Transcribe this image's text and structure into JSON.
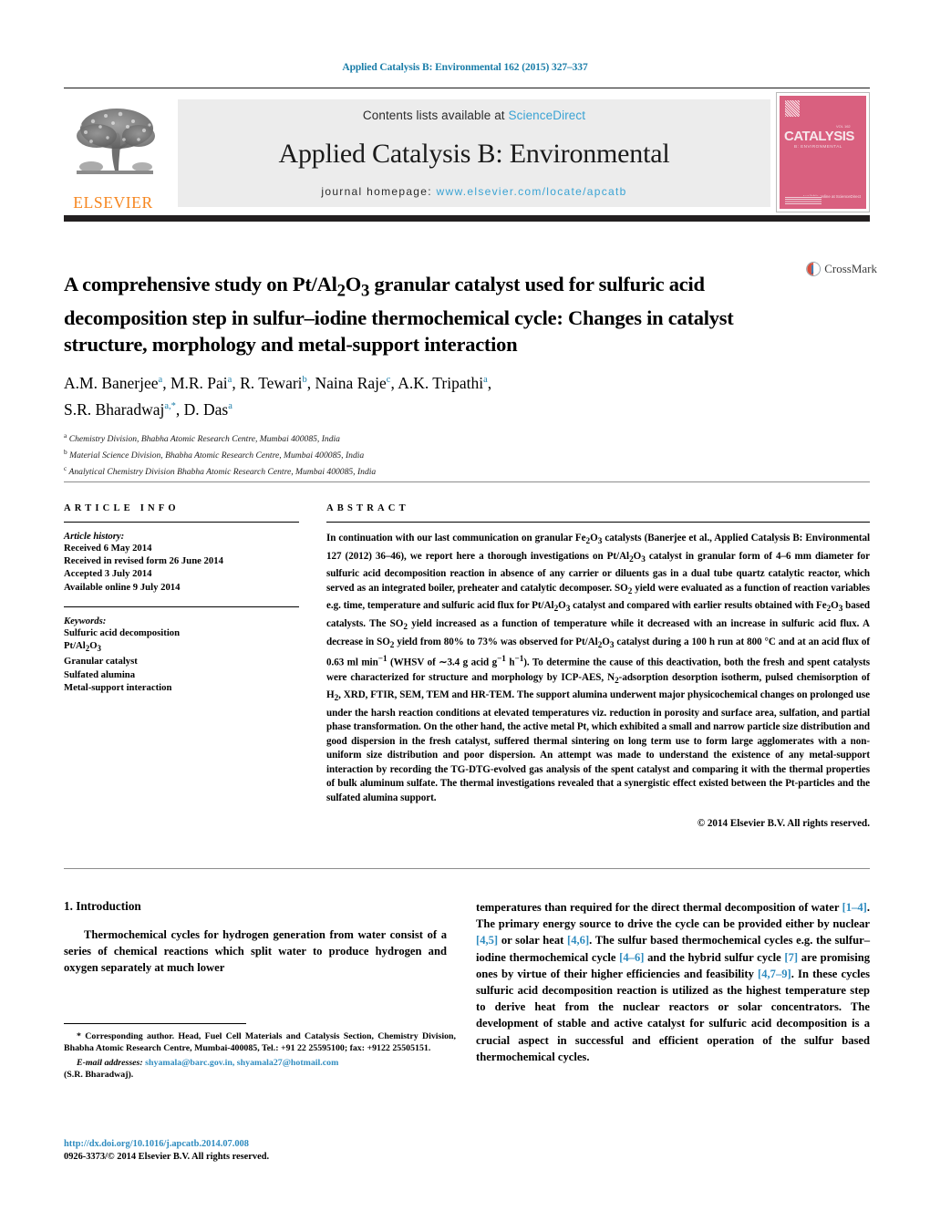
{
  "running_head": "Applied Catalysis B: Environmental 162 (2015) 327–337",
  "masthead": {
    "publisher_name": "ELSEVIER",
    "contents_prefix": "Contents lists available at ",
    "sciencedirect": "ScienceDirect",
    "journal_title": "Applied Catalysis B: Environmental",
    "homepage_label": "journal homepage: ",
    "homepage_url": "www.elsevier.com/locate/apcatb",
    "cover": {
      "title": "CATALYSIS",
      "subtitle": "B: ENVIRONMENTAL",
      "corner_tag": "VOL 162",
      "bottom_note": "Available online at\nScienceDirect",
      "color": "#d9607f"
    }
  },
  "crossmark": {
    "label": "CrossMark"
  },
  "article": {
    "title": "A comprehensive study on Pt/Al2O3 granular catalyst used for sulfuric acid decomposition step in sulfur–iodine thermochemical cycle: Changes in catalyst structure, morphology and metal-support interaction",
    "authors_line1": "A.M. Banerjee a, M.R. Pai a, R. Tewari b, Naina Raje c, A.K. Tripathi a,",
    "authors_line2": "S.R. Bharadwaj a,*, D. Das a",
    "affiliations": [
      {
        "marker": "a",
        "text": "Chemistry Division, Bhabha Atomic Research Centre, Mumbai 400085, India"
      },
      {
        "marker": "b",
        "text": "Material Science Division, Bhabha Atomic Research Centre, Mumbai 400085, India"
      },
      {
        "marker": "c",
        "text": "Analytical Chemistry Division Bhabha Atomic Research Centre, Mumbai 400085, India"
      }
    ]
  },
  "article_info": {
    "heading": "ARTICLE INFO",
    "history_label": "Article history:",
    "history": [
      "Received 6 May 2014",
      "Received in revised form 26 June 2014",
      "Accepted 3 July 2014",
      "Available online 9 July 2014"
    ],
    "keywords_label": "Keywords:",
    "keywords": [
      "Sulfuric acid decomposition",
      "Pt/Al2O3",
      "Granular catalyst",
      "Sulfated alumina",
      "Metal-support interaction"
    ]
  },
  "abstract": {
    "heading": "ABSTRACT",
    "text": "In continuation with our last communication on granular Fe2O3 catalysts (Banerjee et al., Applied Catalysis B: Environmental 127 (2012) 36–46), we report here a thorough investigations on Pt/Al2O3 catalyst in granular form of 4–6 mm diameter for sulfuric acid decomposition reaction in absence of any carrier or diluents gas in a dual tube quartz catalytic reactor, which served as an integrated boiler, preheater and catalytic decomposer. SO2 yield were evaluated as a function of reaction variables e.g. time, temperature and sulfuric acid flux for Pt/Al2O3 catalyst and compared with earlier results obtained with Fe2O3 based catalysts. The SO2 yield increased as a function of temperature while it decreased with an increase in sulfuric acid flux. A decrease in SO2 yield from 80% to 73% was observed for Pt/Al2O3 catalyst during a 100 h run at 800 °C and at an acid flux of 0.63 ml min−1 (WHSV of ∼3.4 g acid g−1 h−1). To determine the cause of this deactivation, both the fresh and spent catalysts were characterized for structure and morphology by ICP-AES, N2-adsorption desorption isotherm, pulsed chemisorption of H2, XRD, FTIR, SEM, TEM and HR-TEM. The support alumina underwent major physicochemical changes on prolonged use under the harsh reaction conditions at elevated temperatures viz. reduction in porosity and surface area, sulfation, and partial phase transformation. On the other hand, the active metal Pt, which exhibited a small and narrow particle size distribution and good dispersion in the fresh catalyst, suffered thermal sintering on long term use to form large agglomerates with a non-uniform size distribution and poor dispersion. An attempt was made to understand the existence of any metal-support interaction by recording the TG-DTG-evolved gas analysis of the spent catalyst and comparing it with the thermal properties of bulk aluminum sulfate. The thermal investigations revealed that a synergistic effect existed between the Pt-particles and the sulfated alumina support.",
    "copyright": "© 2014 Elsevier B.V. All rights reserved."
  },
  "body": {
    "section_number_title": "1. Introduction",
    "left_paragraph": "Thermochemical cycles for hydrogen generation from water consist of a series of chemical reactions which split water to produce hydrogen and oxygen separately at much lower",
    "right_paragraph_parts": [
      "temperatures than required for the direct thermal decomposition of water ",
      "[1–4]",
      ". The primary energy source to drive the cycle can be provided either by nuclear ",
      "[4,5]",
      " or solar heat ",
      "[4,6]",
      ". The sulfur based thermochemical cycles e.g. the sulfur–iodine thermochemical cycle ",
      "[4–6]",
      " and the hybrid sulfur cycle ",
      "[7]",
      " are promising ones by virtue of their higher efficiencies and feasibility ",
      "[4,7–9]",
      ". In these cycles sulfuric acid decomposition reaction is utilized as the highest temperature step to derive heat from the nuclear reactors or solar concentrators. The development of stable and active catalyst for sulfuric acid decomposition is a crucial aspect in successful and efficient operation of the sulfur based thermochemical cycles."
    ]
  },
  "footnotes": {
    "corresponding_marker": "*",
    "corresponding": "Corresponding author. Head, Fuel Cell Materials and Catalysis Section, Chemistry Division, Bhabha Atomic Research Centre, Mumbai-400085, Tel.: +91 22 25595100; fax: +9122 25505151.",
    "email_label": "E-mail addresses:",
    "emails": "shyamala@barc.gov.in, shyamala27@hotmail.com",
    "email_owner": "(S.R. Bharadwaj).",
    "doi": "http://dx.doi.org/10.1016/j.apcatb.2014.07.008",
    "issn_line": "0926-3373/© 2014 Elsevier B.V. All rights reserved."
  },
  "colors": {
    "link": "#2e8bbf",
    "accent": "#1a7da8",
    "elsevier_orange": "#f6861f",
    "bar": "#231f20"
  }
}
